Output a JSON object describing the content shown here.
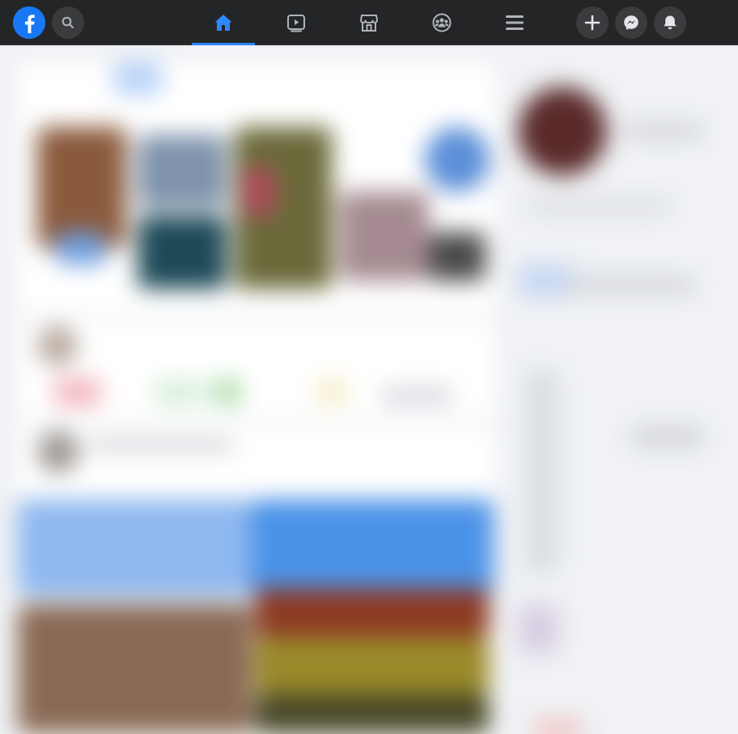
{
  "topbar": {
    "logo": "facebook-logo",
    "search_icon": "search-icon",
    "tabs": [
      {
        "name": "home",
        "icon": "home-icon",
        "active": true
      },
      {
        "name": "watch",
        "icon": "video-icon",
        "active": false
      },
      {
        "name": "marketplace",
        "icon": "store-icon",
        "active": false
      },
      {
        "name": "groups",
        "icon": "groups-icon",
        "active": false
      },
      {
        "name": "menu",
        "icon": "menu-icon",
        "active": false
      }
    ],
    "actions": [
      {
        "name": "create",
        "icon": "plus-icon"
      },
      {
        "name": "messenger",
        "icon": "messenger-icon"
      },
      {
        "name": "notifications",
        "icon": "bell-icon"
      }
    ]
  },
  "colors": {
    "topbar_bg": "#242526",
    "accent": "#2d88ff",
    "brand": "#1877f2",
    "icon": "#b0b3b8",
    "content_bg": "#f0f2f5"
  },
  "content_state": "blurred"
}
